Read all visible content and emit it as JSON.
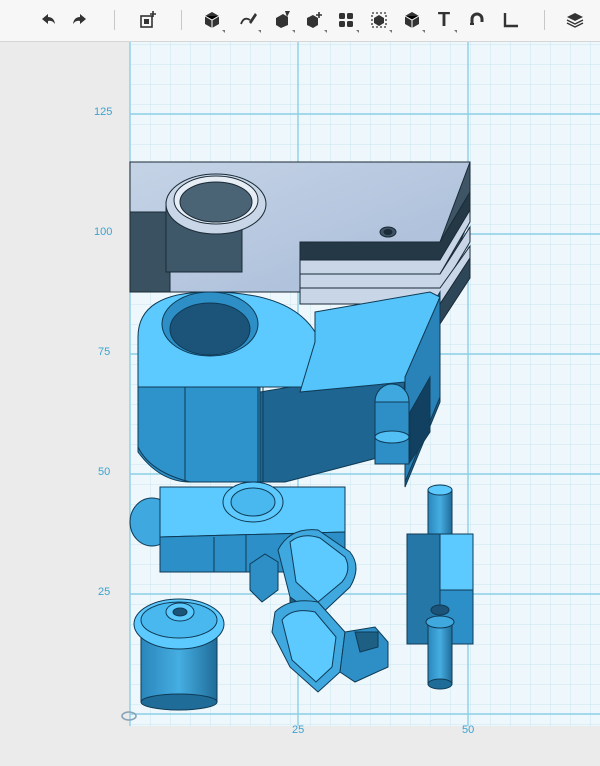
{
  "toolbar": {
    "buttons": [
      {
        "id": "undo",
        "icon": "undo-arrow-icon"
      },
      {
        "id": "redo",
        "icon": "redo-arrow-icon"
      },
      {
        "id": "add-shape",
        "icon": "add-box-icon"
      },
      {
        "id": "primitives",
        "icon": "cube-primitive-icon"
      },
      {
        "id": "sketch",
        "icon": "pencil-sketch-icon"
      },
      {
        "id": "construct",
        "icon": "construct-brush-icon"
      },
      {
        "id": "modify",
        "icon": "modify-cube-icon"
      },
      {
        "id": "pattern",
        "icon": "pattern-grid-icon"
      },
      {
        "id": "grouping",
        "icon": "group-select-icon"
      },
      {
        "id": "combine",
        "icon": "combine-solid-icon"
      },
      {
        "id": "text",
        "icon": "text-icon"
      },
      {
        "id": "snap",
        "icon": "magnet-snap-icon"
      },
      {
        "id": "measure",
        "icon": "measure-corner-icon"
      },
      {
        "id": "material",
        "icon": "material-stack-icon"
      }
    ],
    "text_glyph": "T"
  },
  "grid": {
    "y_ticks": [
      "125",
      "100",
      "75",
      "50",
      "25"
    ],
    "x_ticks": [
      "25",
      "50"
    ]
  },
  "colors": {
    "part_top": "#5ccaff",
    "part_side": "#2d8fc6",
    "part_dark": "#1e5f84",
    "mount_gray": "#b7c7dd",
    "grid_minor": "#c8e7f2",
    "grid_major": "#7fcde6"
  }
}
